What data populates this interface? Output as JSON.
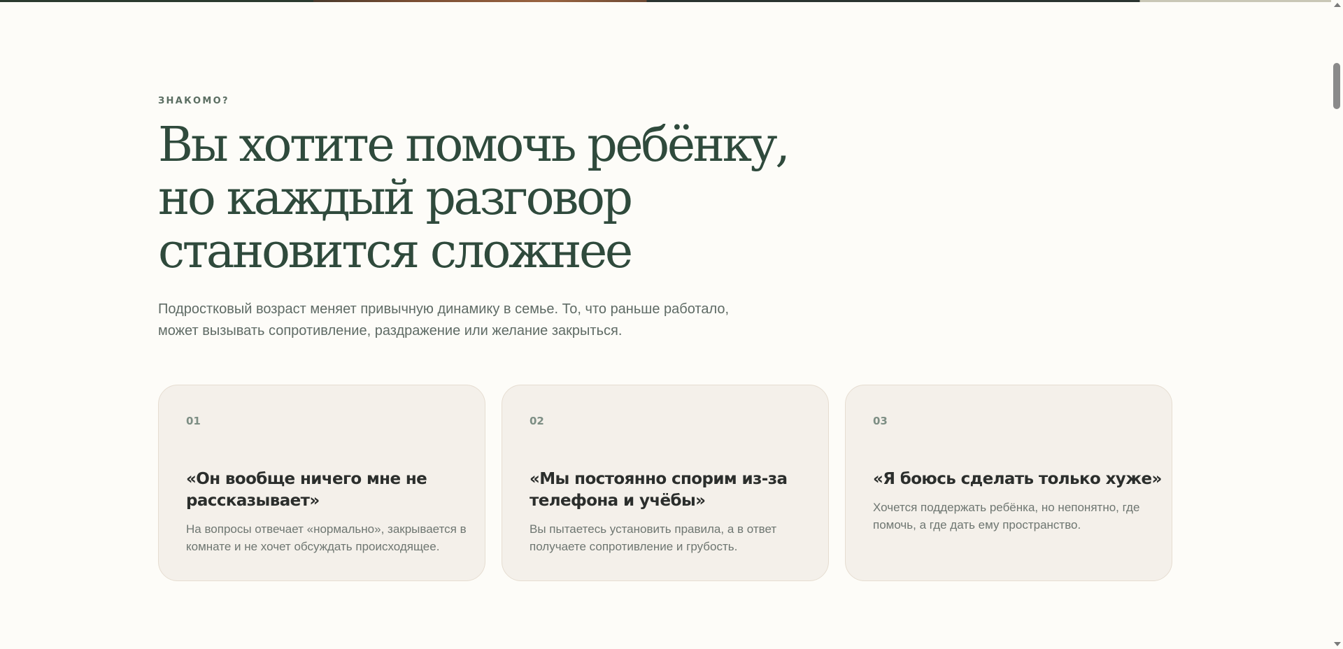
{
  "section": {
    "eyebrow": "ЗНАКОМО?",
    "headline": [
      "Вы хотите помочь ребёнку,",
      "но каждый разговор",
      "становится сложнее"
    ],
    "lead": [
      "Подростковый возраст меняет привычную динамику в семье. То, что раньше работало,",
      "может вызывать сопротивление, раздражение или желание закрыться."
    ]
  },
  "cards": [
    {
      "number": "01",
      "title": [
        "«Он вообще ничего мне не",
        "рассказывает»"
      ],
      "text": [
        "На вопросы отвечает «нормально», закрывается в",
        "комнате и не хочет обсуждать происходящее."
      ]
    },
    {
      "number": "02",
      "title": [
        "«Мы постоянно спорим из-за",
        "телефона и учёбы»"
      ],
      "text": [
        "Вы пытаетесь установить правила, а в ответ",
        "получаете сопротивление и грубость."
      ]
    },
    {
      "number": "03",
      "title": [
        "«Я боюсь сделать только хуже»"
      ],
      "text": [
        "Хочется поддержать ребёнка, но непонятно, где",
        "помочь, а где дать ему пространство."
      ]
    }
  ],
  "colors": {
    "background": "#fdfcf8",
    "headline": "#2f4a3c",
    "card_background": "#f4f0ea",
    "card_border": "#e6ddd1",
    "accent_muted": "#7d8e84"
  }
}
